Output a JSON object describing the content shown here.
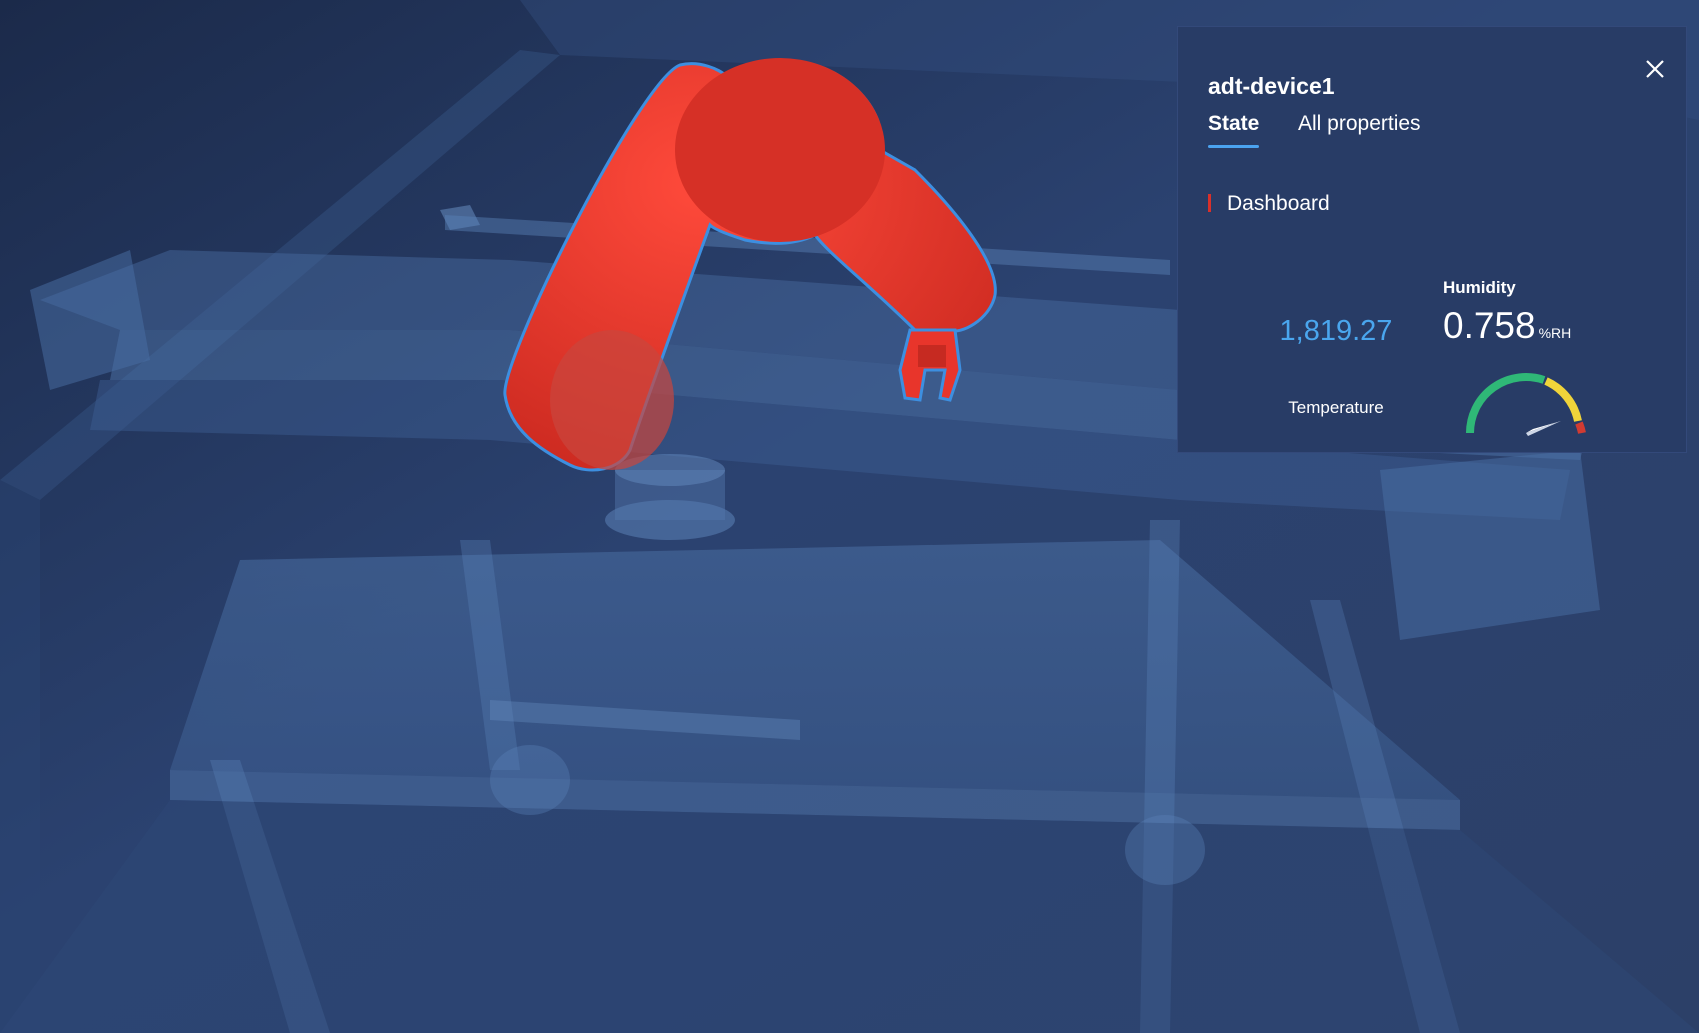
{
  "panel": {
    "title": "adt-device1",
    "tabs": [
      {
        "label": "State",
        "active": true
      },
      {
        "label": "All properties",
        "active": false
      }
    ],
    "section": {
      "label": "Dashboard"
    },
    "kpi": {
      "value": "1,819.27",
      "label": "Temperature"
    },
    "gauge": {
      "title": "Humidity",
      "value": "0.758",
      "unit": "%RH",
      "bands": [
        "#2fb877",
        "#f0d43a",
        "#d13b32"
      ]
    }
  },
  "colors": {
    "background": "#2a3f66",
    "panel": "#283c66",
    "accent": "#4ba3f0",
    "robot": "#e8352b",
    "robot_outline": "#3d8fe0"
  },
  "icons": {
    "close": "close-icon"
  }
}
